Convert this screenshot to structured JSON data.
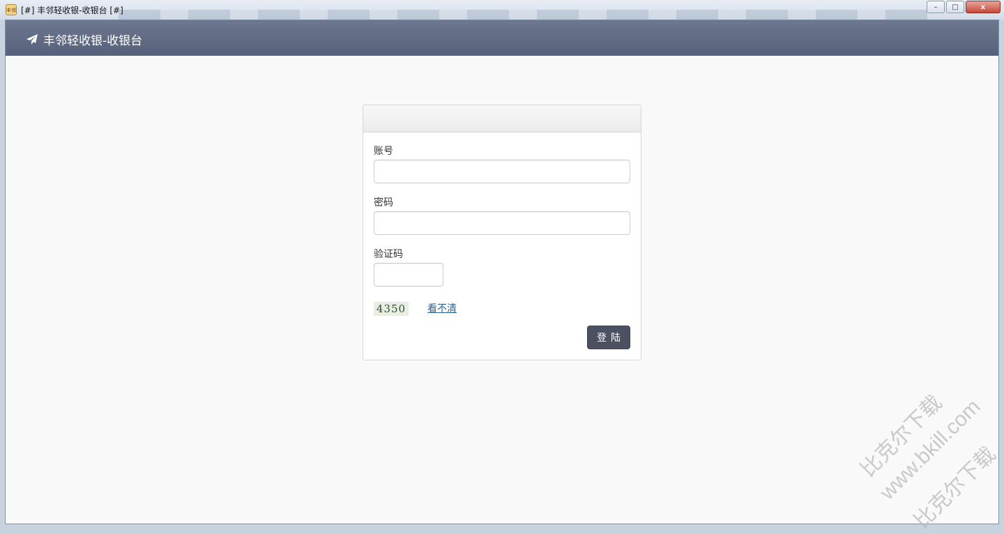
{
  "window": {
    "icon_text": "丰邻",
    "title": "[#] 丰邻轻收银-收银台 [#]",
    "controls": {
      "minimize": "–",
      "maximize": "□",
      "close": "x"
    }
  },
  "navbar": {
    "icon": "paper-plane-icon",
    "brand": "丰邻轻收银-收银台"
  },
  "login": {
    "account_label": "账号",
    "account_value": "",
    "password_label": "密码",
    "password_value": "",
    "captcha_label": "验证码",
    "captcha_value": "",
    "captcha_image_text": "4350",
    "refresh_link": "看不清",
    "submit_label": "登陆"
  },
  "watermark": {
    "line1": "比克尔下载",
    "line2": "www.bkill.com",
    "line3": "比克尔下载"
  },
  "colors": {
    "navbar": "#5d6780",
    "button": "#4b5161",
    "link": "#2a6496",
    "background": "#f9f9f9"
  }
}
